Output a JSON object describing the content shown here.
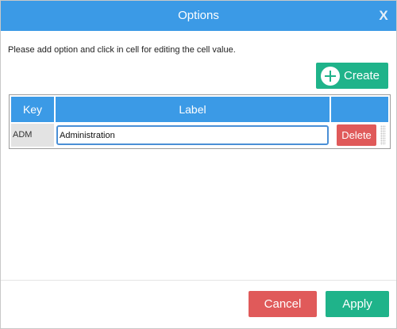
{
  "dialog": {
    "title": "Options",
    "close_glyph": "X",
    "close_icon": "close-icon"
  },
  "instruction": "Please add option and click in cell for editing the cell value.",
  "create_button": {
    "label": "Create",
    "icon": "plus-circle-icon"
  },
  "grid": {
    "columns": [
      "Key",
      "Label",
      ""
    ],
    "rows": [
      {
        "key": "ADM",
        "label": "Administration",
        "action_label": "Delete"
      }
    ]
  },
  "footer": {
    "cancel_label": "Cancel",
    "apply_label": "Apply"
  },
  "colors": {
    "header_blue": "#3b9ae6",
    "create_green": "#1fb38a",
    "delete_red": "#e05a5a",
    "apply_green": "#1fb38a",
    "cancel_red": "#e05a5a"
  }
}
